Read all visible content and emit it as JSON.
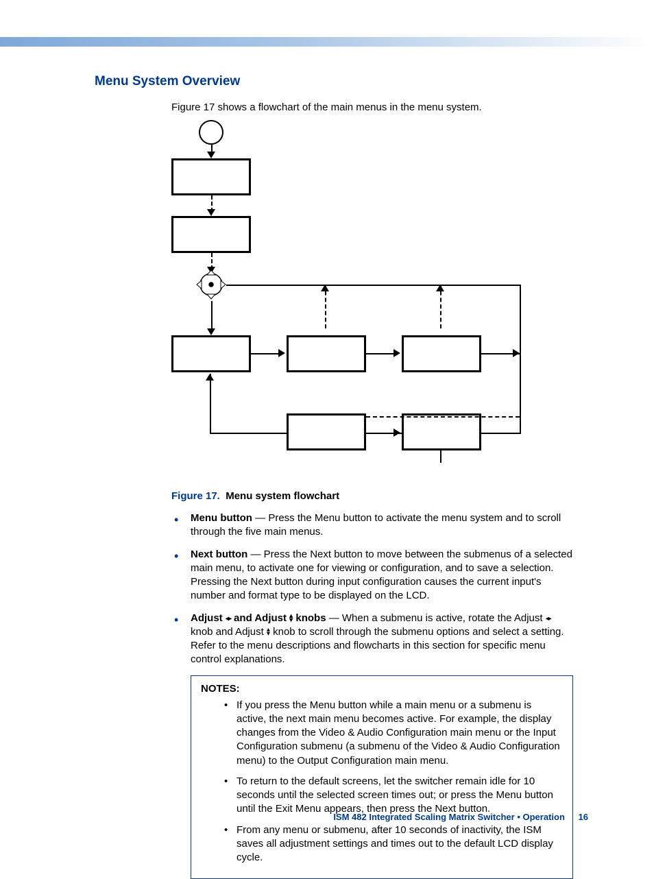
{
  "heading": "Menu System Overview",
  "intro": "Figure 17 shows a flowchart of the main menus in the menu system.",
  "figure": {
    "ref": "Figure 17.",
    "title": "Menu system flowchart"
  },
  "bullets": {
    "menu": {
      "term": "Menu button",
      "dash": " — ",
      "text": "Press the Menu button to activate the menu system and to scroll through the five main menus."
    },
    "next": {
      "term": "Next button",
      "dash": " — ",
      "text": "Press the Next button to move between the submenus of a selected main menu, to activate one for viewing or configuration, and to save a selection. Pressing the Next button during input configuration causes the current input's number and format type to be displayed on the LCD."
    },
    "adjust": {
      "term_pre": "Adjust ",
      "term_mid": " and Adjust ",
      "term_post": " knobs",
      "dash": " — ",
      "t1": "When a submenu is active, rotate the Adjust ",
      "t2": " knob and Adjust ",
      "t3": " knob to scroll through the submenu options and select a setting. Refer to the menu descriptions and flowcharts in this section for specific menu control explanations."
    }
  },
  "notes": {
    "heading": "NOTES:",
    "items": [
      "If you press the Menu button while a main menu or a submenu is active, the next main menu becomes active. For example, the display changes from the Video & Audio Configuration main menu or the Input Configuration submenu (a submenu of the Video & Audio Configuration menu) to the Output Configuration main menu.",
      "To return to the default screens, let the switcher remain idle for 10 seconds until the selected screen times out; or press the Menu button until the Exit Menu appears, then press the Next button.",
      "From any menu or submenu, after 10 seconds of inactivity, the ISM saves all adjustment settings and times out to the default LCD display cycle."
    ]
  },
  "footer": {
    "text": "ISM 482 Integrated Scaling Matrix Switcher • Operation",
    "page": "16"
  },
  "icons": {
    "lr": "◂▸",
    "ud_up": "▴",
    "ud_dn": "▾"
  }
}
